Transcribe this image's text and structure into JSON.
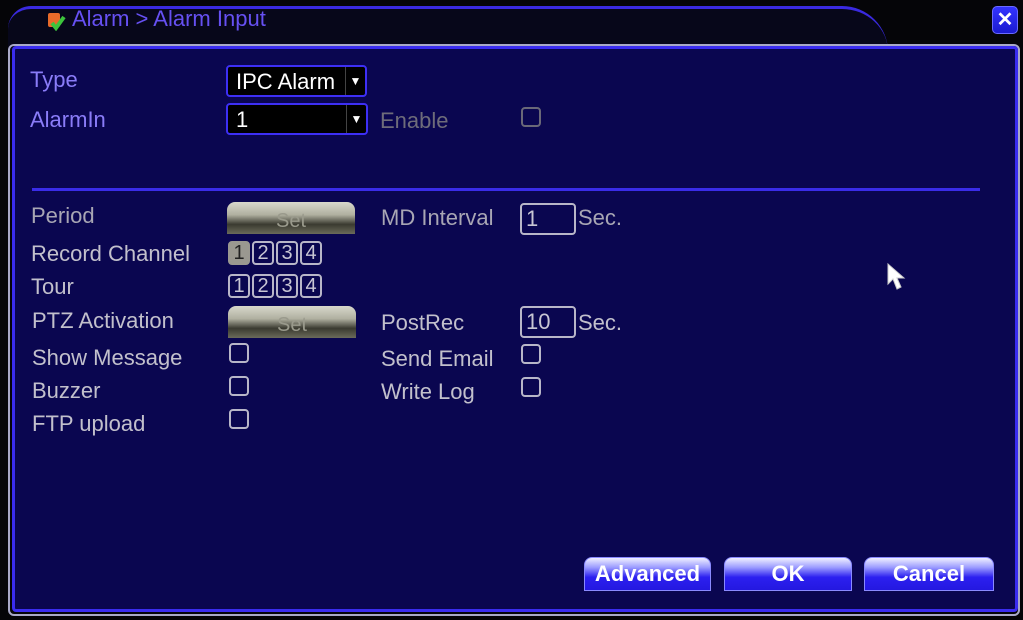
{
  "window": {
    "title": "Alarm > Alarm Input",
    "close_icon": "close-icon"
  },
  "form": {
    "type": {
      "label": "Type",
      "value": "IPC Alarm"
    },
    "alarm_in": {
      "label": "AlarmIn",
      "value": "1"
    },
    "enable": {
      "label": "Enable",
      "checked": false
    },
    "period": {
      "label": "Period",
      "button": "Set"
    },
    "md_interval": {
      "label": "MD Interval",
      "value": "1",
      "unit": "Sec."
    },
    "record_channel": {
      "label": "Record Channel",
      "channels": [
        "1",
        "2",
        "3",
        "4"
      ],
      "selected": [
        "1"
      ]
    },
    "tour": {
      "label": "Tour",
      "channels": [
        "1",
        "2",
        "3",
        "4"
      ],
      "selected": []
    },
    "ptz_activation": {
      "label": "PTZ Activation",
      "button": "Set"
    },
    "post_rec": {
      "label": "PostRec",
      "value": "10",
      "unit": "Sec."
    },
    "show_message": {
      "label": "Show Message",
      "checked": false
    },
    "send_email": {
      "label": "Send Email",
      "checked": false
    },
    "buzzer": {
      "label": "Buzzer",
      "checked": false
    },
    "write_log": {
      "label": "Write Log",
      "checked": false
    },
    "ftp_upload": {
      "label": "FTP upload",
      "checked": false
    }
  },
  "footer": {
    "advanced": "Advanced",
    "ok": "OK",
    "cancel": "Cancel"
  },
  "colors": {
    "panel_bg": "#0a0650",
    "accent_border": "#3a2cf0",
    "active_label": "#8a7cf8",
    "title_text": "#6650f2"
  }
}
